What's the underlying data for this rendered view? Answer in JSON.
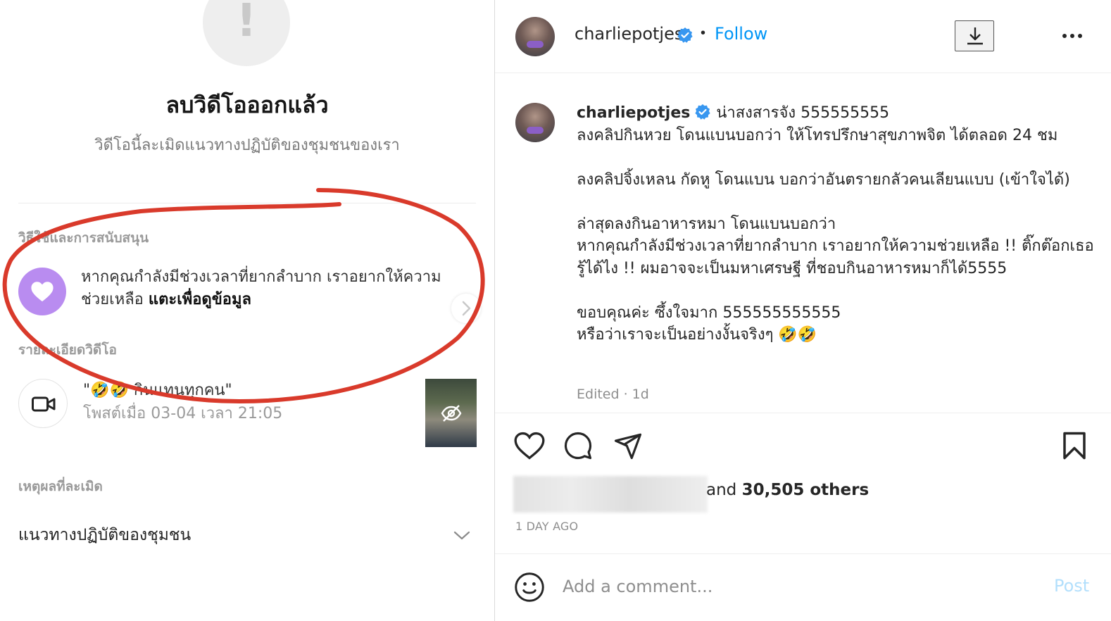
{
  "left_panel": {
    "warning_symbol": "!",
    "removed_title": "ลบวิดีโอออกแล้ว",
    "removed_subtitle": "วิดีโอนี้ละเมิดแนวทางปฏิบัติของชุมชนของเรา",
    "support_section_label": "วิธีใช้และการสนับสนุน",
    "help_text": "หากคุณกำลังมีช่วงเวลาที่ยากลำบาก เราอยากให้ความช่วยเหลือ",
    "help_link": "แตะเพื่อดูข้อมูล",
    "video_details_label": "รายละเอียดวิดีโอ",
    "video_title": "\"🤣🤣 กินแทนทุกคน\"",
    "video_posted": "โพสต์เมื่อ 03-04 เวลา 21:05",
    "violation_reason_label": "เหตุผลที่ละเมิด",
    "policy_name": "แนวทางปฏิบัติของชุมชน",
    "annotation_color": "#d93a2b",
    "help_icon_color": "#b98cf0"
  },
  "post": {
    "username": "charliepotjes",
    "verified": true,
    "follow_label": "Follow",
    "caption_username": "charliepotjes",
    "caption": " น่าสงสารจัง 555555555\nลงคลิปกินหวย โดนแบนบอกว่า ให้โทรปรึกษาสุขภาพจิต ได้ตลอด 24 ชม\n\nลงคลิปจิ้งเหลน กัดหู โดนแบน บอกว่าอันตรายกลัวคนเลียนแบบ (เข้าใจได้)\n\nล่าสุดลงกินอาหารหมา โดนแบนบอกว่า\nหากคุณกำลังมีช่วงเวลาที่ยากลำบาก เราอยากให้ความช่วยเหลือ !! ติ๊กต๊อกเธอรู้ได้ไง !! ผมอาจจะเป็นมหาเศรษฐี ที่ชอบกินอาหารหมาก็ได้5555\n\nขอบคุณค่ะ ซึ้งใจมาก 555555555555\nหรือว่าเราจะเป็นอย่างงั้นจริงๆ 🤣🤣",
    "edited": "Edited · 1d",
    "likes_prefix": "and ",
    "likes_count": "30,505 others",
    "time_ago": "1 DAY AGO",
    "comment_placeholder": "Add a comment...",
    "post_label": "Post",
    "accent_color": "#0095f6",
    "verified_color": "#3897f0"
  },
  "icons": {
    "header": [
      "avatar",
      "verified-badge-icon",
      "download-icon",
      "more-options-icon"
    ],
    "actions": [
      "heart-icon",
      "comment-icon",
      "share-icon",
      "bookmark-icon"
    ],
    "comment": [
      "emoji-icon"
    ],
    "left": [
      "heart-icon",
      "chevron-right-icon",
      "video-camera-icon",
      "hidden-eye-icon",
      "chevron-down-icon"
    ]
  }
}
